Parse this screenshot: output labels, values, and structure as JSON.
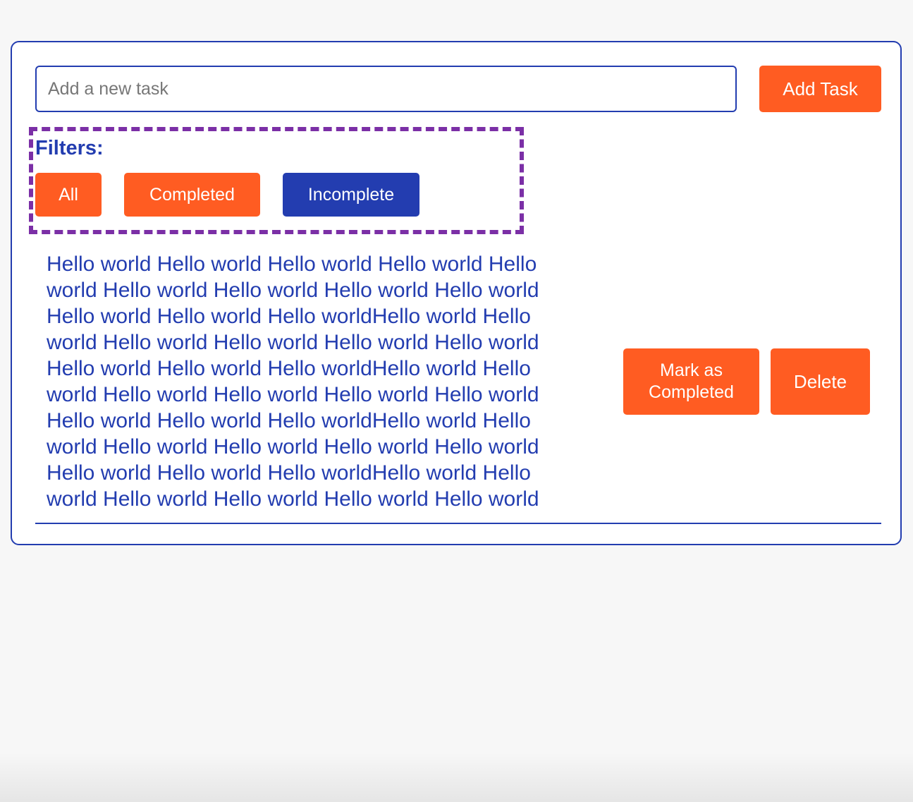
{
  "add_task": {
    "input_placeholder": "Add a new task",
    "input_value": "",
    "button_label": "Add Task"
  },
  "filters": {
    "title": "Filters:",
    "buttons": [
      {
        "label": "All"
      },
      {
        "label": "Completed"
      },
      {
        "label": "Incomplete"
      }
    ],
    "active": "Incomplete"
  },
  "tasks": [
    {
      "text": "Hello world Hello world Hello world Hello world Hello world Hello world Hello world Hello world Hello world Hello world Hello world Hello worldHello world Hello world Hello world Hello world Hello world Hello world Hello world Hello world Hello worldHello world Hello world Hello world Hello world Hello world Hello world Hello world Hello world Hello worldHello world Hello world Hello world Hello world Hello world Hello world Hello world Hello world Hello worldHello world Hello world Hello world Hello world Hello world Hello world",
      "mark_completed_label": "Mark as Completed",
      "delete_label": "Delete"
    }
  ],
  "colors": {
    "accent_orange": "#ff5c22",
    "accent_blue": "#233db0",
    "filter_border": "#7b2fa6",
    "page_background": "#f7f7f7"
  }
}
